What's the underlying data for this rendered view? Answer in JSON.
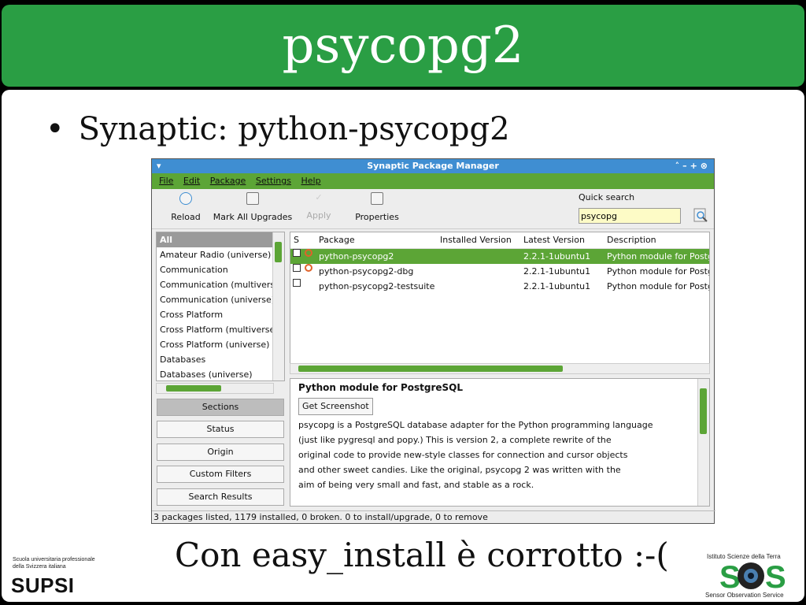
{
  "slide": {
    "title": "psycopg2",
    "bullet": "Synaptic: python-psycopg2",
    "bullet_marker": "•",
    "footer_text": "Con easy_install è corrotto :-(",
    "supsi_line1": "Scuola universitaria professionale",
    "supsi_line2": "della Svizzera italiana",
    "supsi_logo": "SUPSI",
    "sos_top": "Istituto Scienze della Terra",
    "sos_logo": "SOS",
    "sos_bottom": "Sensor Observation Service",
    "colors": {
      "title_bar": "#2a9e44",
      "background": "#ffffff",
      "frame": "#000000"
    }
  },
  "window": {
    "title": "Synaptic Package Manager",
    "menu": [
      "File",
      "Edit",
      "Package",
      "Settings",
      "Help"
    ],
    "toolbar": {
      "reload": "Reload",
      "mark_all": "Mark All Upgrades",
      "apply": "Apply",
      "properties": "Properties"
    },
    "quick_search": {
      "label": "Quick search",
      "value": "psycopg"
    },
    "sections": [
      "All",
      "Amateur Radio (universe)",
      "Communication",
      "Communication (multiverse)",
      "Communication (universe)",
      "Cross Platform",
      "Cross Platform (multiverse)",
      "Cross Platform (universe)",
      "Databases",
      "Databases (universe)"
    ],
    "filter_buttons": {
      "sections": "Sections",
      "status": "Status",
      "origin": "Origin",
      "custom": "Custom Filters",
      "search": "Search Results"
    },
    "table": {
      "headers": {
        "s": "S",
        "package": "Package",
        "installed": "Installed Version",
        "latest": "Latest Version",
        "description": "Description"
      },
      "rows": [
        {
          "package": "python-psycopg2",
          "installed": "",
          "latest": "2.2.1-1ubuntu1",
          "description": "Python module for PostgreSQL"
        },
        {
          "package": "python-psycopg2-dbg",
          "installed": "",
          "latest": "2.2.1-1ubuntu1",
          "description": "Python module for PostgreSQL"
        },
        {
          "package": "python-psycopg2-testsuite",
          "installed": "",
          "latest": "2.2.1-1ubuntu1",
          "description": "Python module for PostgreSQL"
        }
      ]
    },
    "details": {
      "title": "Python module for PostgreSQL",
      "screenshot_button": "Get Screenshot",
      "lines": [
        "psycopg is a PostgreSQL database adapter for the Python programming language",
        "(just like pygresql and popy.) This is version 2, a complete rewrite of the",
        "original code to provide new-style classes for connection and cursor objects",
        "and other sweet candies. Like the original, psycopg 2 was written with the",
        "aim of being very small and fast, and stable as a rock."
      ]
    },
    "status": "3 packages listed, 1179 installed, 0 broken. 0 to install/upgrade, 0 to remove",
    "accent_color": "#5ca536",
    "titlebar_color": "#3f8ed2"
  }
}
